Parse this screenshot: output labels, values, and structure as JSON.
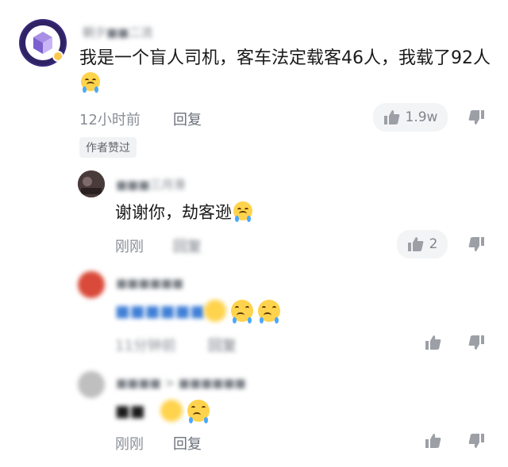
{
  "comments": [
    {
      "username": "朝夕■■二流",
      "text": "我是一个盲人司机，客车法定载客46人，我载了92人",
      "emoji": "crying-emoji",
      "time": "12小时前",
      "reply": "回复",
      "likes": "1.9w",
      "badge": "作者赞过"
    },
    {
      "username": "■■■三月滑",
      "text": "谢谢你，劫客逊",
      "emoji": "crying-emoji",
      "time": "刚刚",
      "reply": "回复",
      "likes": "2"
    },
    {
      "username": "■■■■■■",
      "text": "■■■■■■",
      "time": "11分钟前",
      "reply": "回复"
    },
    {
      "username": "■■■■ > ■■■■■■",
      "text": "■■",
      "time": "刚刚",
      "reply": "回复"
    }
  ],
  "colors": {
    "tear": "#4aa7ff",
    "emoji": "#ffd34d",
    "meta": "#8a8f96"
  }
}
